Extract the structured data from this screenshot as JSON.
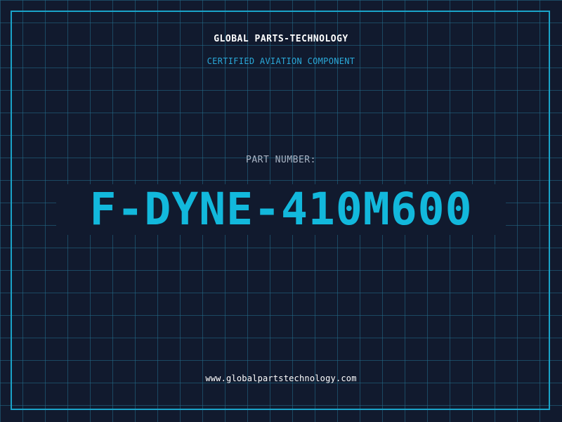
{
  "header": {
    "brand": "GLOBAL PARTS-TECHNOLOGY",
    "tagline": "CERTIFIED AVIATION COMPONENT"
  },
  "part": {
    "label": "PART NUMBER:",
    "number": "F-DYNE-410M600"
  },
  "footer": {
    "url": "www.globalpartstechnology.com"
  },
  "colors": {
    "background": "#111a2e",
    "grid": "#236e8c",
    "accent": "#12b8dc",
    "border": "#1aa3c8",
    "label": "#a9b4c4",
    "text": "#ffffff"
  }
}
